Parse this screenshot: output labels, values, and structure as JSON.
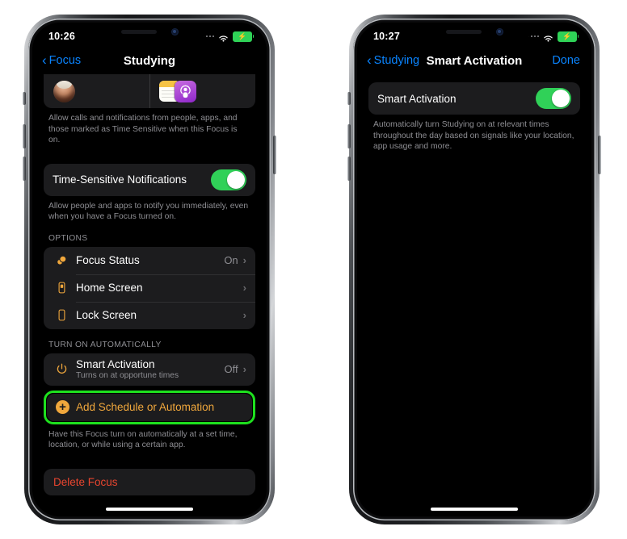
{
  "meta": {
    "background": "#ffffff",
    "accent_blue": "#0a84ff",
    "accent_orange": "#f0a73c",
    "toggle_green": "#30d158",
    "highlight_green": "#1ee01e",
    "destructive_red": "#e8452f",
    "card_bg": "#1c1c1e",
    "secondary_text": "#8e8e93"
  },
  "phone_left": {
    "status_bar": {
      "time": "10:26",
      "signal_icon": "cellular-signal-icon",
      "wifi_icon": "wifi-icon",
      "battery_icon": "battery-charging-icon",
      "battery_bolt": "⚡"
    },
    "nav": {
      "back_icon": "chevron-left-icon",
      "back_label": "Focus",
      "title": "Studying"
    },
    "people_apps_card": {
      "people_avatar": "person-avatar",
      "app_icons": [
        "notes-app-icon",
        "podcasts-app-icon"
      ]
    },
    "allow_footnote": "Allow calls and notifications from people, apps, and those marked as Time Sensitive when this Focus is on.",
    "time_sensitive": {
      "label": "Time-Sensitive Notifications",
      "toggle_state": "on",
      "toggle_name": "time-sensitive-notifications-toggle"
    },
    "time_sensitive_footnote": "Allow people and apps to notify you immediately, even when you have a Focus turned on.",
    "options_header": "OPTIONS",
    "options_rows": [
      {
        "icon": "focus-status-icon",
        "label": "Focus Status",
        "value": "On",
        "chevron": "›"
      },
      {
        "icon": "home-screen-icon",
        "label": "Home Screen",
        "value": "",
        "chevron": "›"
      },
      {
        "icon": "lock-screen-icon",
        "label": "Lock Screen",
        "value": "",
        "chevron": "›"
      }
    ],
    "turn_on_header": "TURN ON AUTOMATICALLY",
    "smart_activation_row": {
      "icon": "power-icon",
      "label": "Smart Activation",
      "sublabel": "Turns on at opportune times",
      "value": "Off",
      "chevron": "›"
    },
    "add_schedule": {
      "icon": "plus-circle-icon",
      "label": "Add Schedule or Automation",
      "highlighted": true
    },
    "add_schedule_footnote": "Have this Focus turn on automatically at a set time, location, or while using a certain app.",
    "delete_focus_label": "Delete Focus",
    "home_indicator": "home-indicator"
  },
  "phone_right": {
    "status_bar": {
      "time": "10:27",
      "signal_icon": "cellular-signal-icon",
      "wifi_icon": "wifi-icon",
      "battery_icon": "battery-charging-icon",
      "battery_bolt": "⚡"
    },
    "nav": {
      "back_icon": "chevron-left-icon",
      "back_label": "Studying",
      "title": "Smart Activation",
      "done_label": "Done"
    },
    "smart_activation": {
      "label": "Smart Activation",
      "toggle_state": "on",
      "toggle_name": "smart-activation-toggle"
    },
    "footnote": "Automatically turn Studying on at relevant times throughout the day based on signals like your location, app usage and more.",
    "home_indicator": "home-indicator"
  }
}
